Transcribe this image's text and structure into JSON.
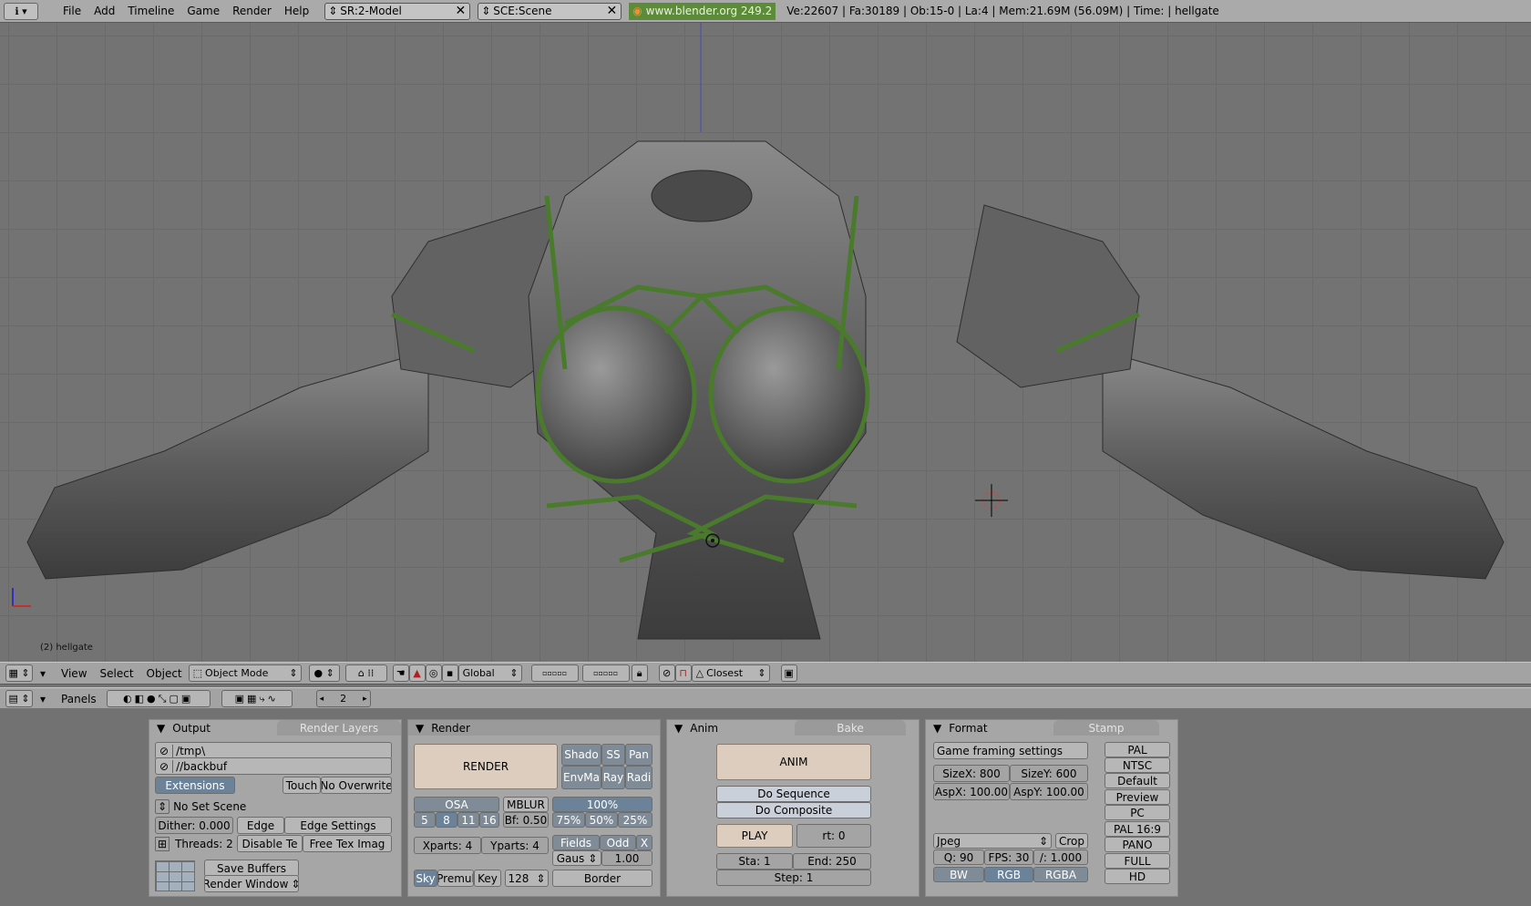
{
  "top": {
    "menus": [
      "File",
      "Add",
      "Timeline",
      "Game",
      "Render",
      "Help"
    ],
    "screen": "SR:2-Model",
    "scene": "SCE:Scene",
    "url": "www.blender.org 249.2",
    "stats": "Ve:22607 | Fa:30189 | Ob:15-0 | La:4 | Mem:21.69M (56.09M) | Time: | hellgate"
  },
  "viewport": {
    "object_label": "(2) hellgate"
  },
  "view3d_header": {
    "menus": [
      "View",
      "Select",
      "Object"
    ],
    "mode": "Object Mode",
    "orientation": "Global",
    "snap": "Closest"
  },
  "buttons_header": {
    "label": "Panels",
    "frame": "2"
  },
  "output": {
    "tab_active": "Output",
    "tab_inactive": "Render Layers",
    "path1": "/tmp\\",
    "path2": "//backbuf",
    "extensions": "Extensions",
    "touch": "Touch",
    "no_overwrite": "No Overwrite",
    "set_scene": "No Set Scene",
    "dither": "Dither: 0.000",
    "edge": "Edge",
    "edge_settings": "Edge Settings",
    "threads": "Threads: 2",
    "disable_tex": "Disable Te",
    "free_tex": "Free Tex Imag",
    "save_buffers": "Save Buffers",
    "render_window": "Render Window"
  },
  "render": {
    "title": "Render",
    "render_btn": "RENDER",
    "shadow": "Shado",
    "ss": "SS",
    "pan": "Pan",
    "envmap": "EnvMa",
    "ray": "Ray",
    "radio": "Radi",
    "osa": "OSA",
    "osa_values": [
      "5",
      "8",
      "11",
      "16"
    ],
    "mblur": "MBLUR",
    "bf": "Bf: 0.50",
    "percent": "100%",
    "percents": [
      "75%",
      "50%",
      "25%"
    ],
    "xparts": "Xparts: 4",
    "yparts": "Yparts: 4",
    "fields": "Fields",
    "odd": "Odd",
    "x": "X",
    "gauss": "Gaus",
    "gauss_val": "1.00",
    "sky": "Sky",
    "premul": "Premul",
    "key": "Key",
    "bits": "128",
    "border": "Border"
  },
  "anim": {
    "tab_active": "Anim",
    "tab_inactive": "Bake",
    "anim_btn": "ANIM",
    "do_sequence": "Do Sequence",
    "do_composite": "Do Composite",
    "play": "PLAY",
    "rt": "rt: 0",
    "sta": "Sta: 1",
    "end": "End: 250",
    "step": "Step: 1"
  },
  "format": {
    "tab_active": "Format",
    "tab_inactive": "Stamp",
    "preset": "Game framing settings",
    "sizex": "SizeX: 800",
    "sizey": "SizeY: 600",
    "aspx": "AspX: 100.00",
    "aspy": "AspY: 100.00",
    "codec": "Jpeg",
    "crop": "Crop",
    "quality": "Q: 90",
    "fps": "FPS: 30",
    "fps_base": "/: 1.000",
    "bw": "BW",
    "rgb": "RGB",
    "rgba": "RGBA",
    "presets": [
      "PAL",
      "NTSC",
      "Default",
      "Preview",
      "PC",
      "PAL 16:9",
      "PANO",
      "FULL",
      "HD"
    ]
  },
  "colors": {
    "header": "#a3a3a3",
    "panel": "#a6a6a6",
    "selected": "#6b8298",
    "render_btn": "#ddcdbf",
    "armor_trim": "#4a7a2c"
  }
}
